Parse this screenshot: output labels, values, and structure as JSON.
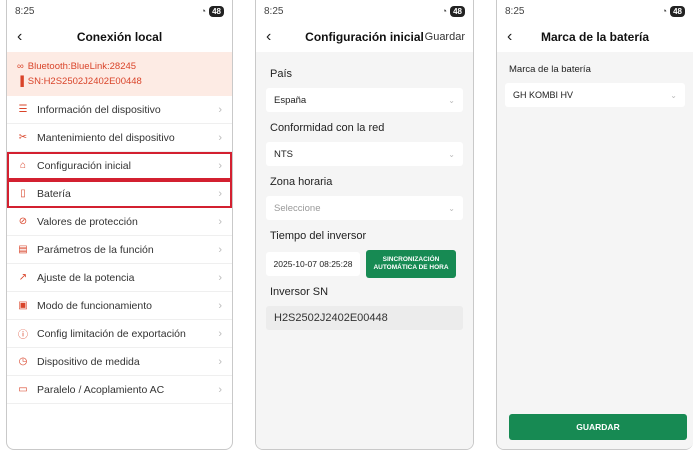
{
  "status": {
    "time": "8:25",
    "battery": "48"
  },
  "panel1": {
    "title": "Conexión local",
    "bluetooth": "Bluetooth:BlueLink:28245",
    "sn": "SN:H2S2502J2402E00448",
    "items": [
      {
        "label": "Información del dispositivo"
      },
      {
        "label": "Mantenimiento del dispositivo"
      },
      {
        "label": "Configuración inicial"
      },
      {
        "label": "Batería"
      },
      {
        "label": "Valores de protección"
      },
      {
        "label": "Parámetros de la función"
      },
      {
        "label": "Ajuste de la potencia"
      },
      {
        "label": "Modo de funcionamiento"
      },
      {
        "label": "Config limitación de exportación"
      },
      {
        "label": "Dispositivo de medida"
      },
      {
        "label": "Paralelo / Acoplamiento AC"
      }
    ]
  },
  "panel2": {
    "title": "Configuración inicial",
    "save": "Guardar",
    "country_label": "País",
    "country_value": "España",
    "grid_label": "Conformidad con la red",
    "grid_value": "NTS",
    "tz_label": "Zona horaria",
    "tz_placeholder": "Seleccione",
    "time_label": "Tiempo del inversor",
    "time_value": "2025-10-07 08:25:28",
    "sync_button": "SINCRONIZACIÓN AUTOMÁTICA DE HORA",
    "sn_label": "Inversor SN",
    "sn_value": "H2S2502J2402E00448"
  },
  "panel3": {
    "title": "Marca de la batería",
    "brand_label": "Marca de la batería",
    "brand_value": "GH KOMBI HV",
    "save_button": "GUARDAR"
  },
  "colors": {
    "accent_red": "#d9442a",
    "highlight_border": "#d32030",
    "green": "#178a53"
  }
}
